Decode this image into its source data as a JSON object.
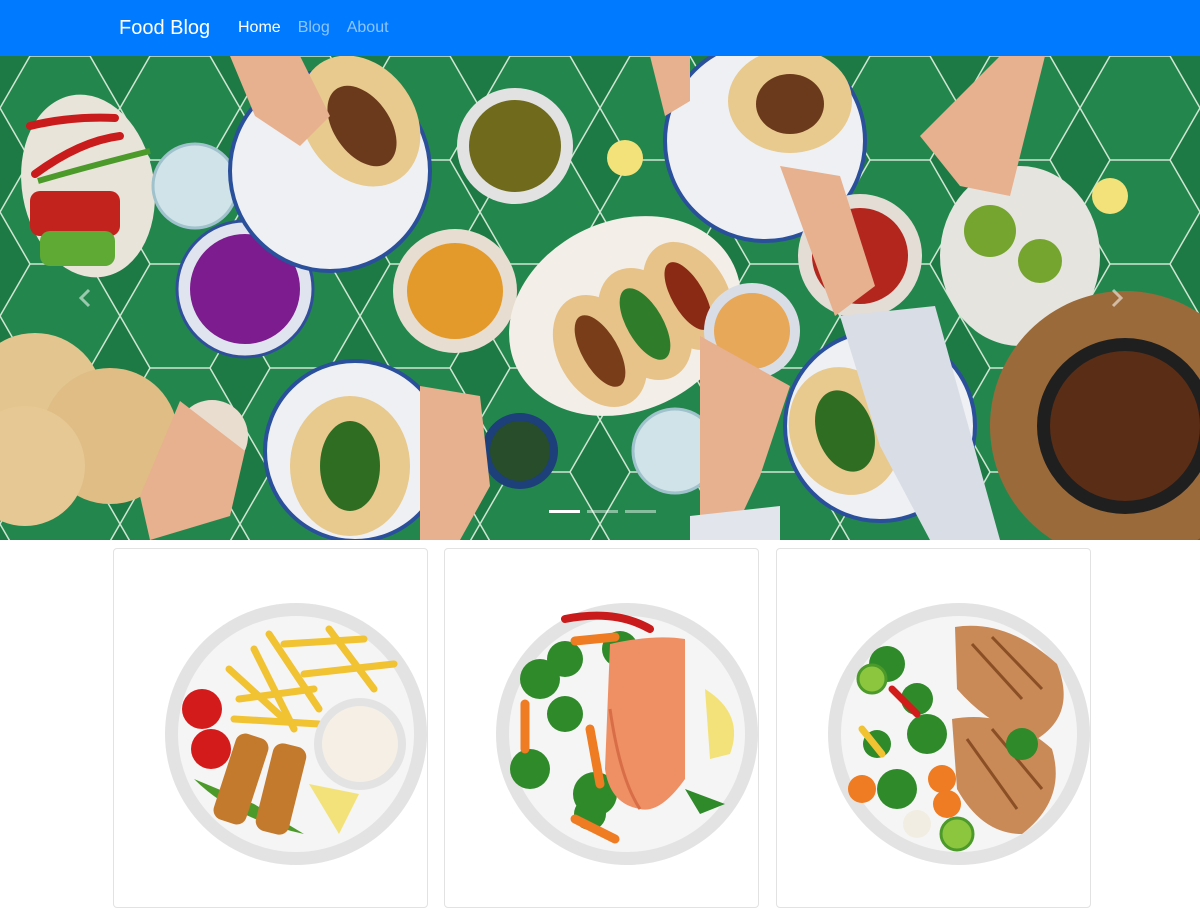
{
  "navbar": {
    "brand": "Food Blog",
    "links": [
      {
        "label": "Home",
        "active": true
      },
      {
        "label": "Blog",
        "active": false
      },
      {
        "label": "About",
        "active": false
      }
    ],
    "background": "#007bff"
  },
  "carousel": {
    "slide_count": 3,
    "active_index": 0,
    "prev_icon": "chevron-left-icon",
    "next_icon": "chevron-right-icon",
    "tile_color": "#1f7f48"
  },
  "cards": [
    {
      "dish": "fish-sticks-fries-plate"
    },
    {
      "dish": "salmon-vegetables-plate"
    },
    {
      "dish": "grilled-chicken-vegetables-plate"
    }
  ]
}
